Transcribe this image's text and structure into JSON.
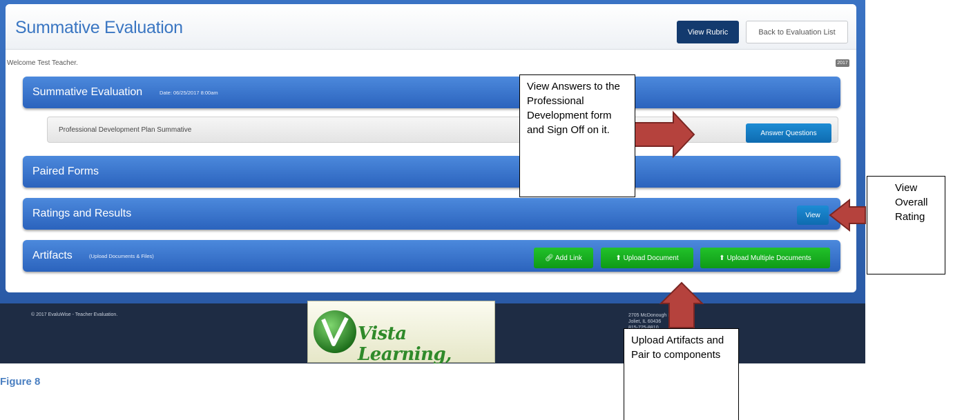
{
  "header": {
    "title": "Summative Evaluation",
    "view_rubric_label": "View Rubric",
    "back_label": "Back to Evaluation List"
  },
  "welcome_text": "Welcome Test Teacher.",
  "year_badge": "2017",
  "sections": {
    "summative": {
      "title": "Summative Evaluation",
      "date": "Date: 06/25/2017 8:00am",
      "item_label": "Professional Development Plan Summative",
      "answer_label": "Answer Questions"
    },
    "paired_forms": {
      "title": "Paired Forms"
    },
    "ratings": {
      "title": "Ratings and Results",
      "view_label": "View"
    },
    "artifacts": {
      "title": "Artifacts",
      "subtitle": "(Upload Documents & Files)",
      "add_link_label": "Add Link",
      "upload_doc_label": "Upload Document",
      "upload_multi_label": "Upload Multiple Documents"
    }
  },
  "footer": {
    "copyright": "© 2017 EvaluWise - Teacher Evaluation.",
    "address_line1": "2705 McDonough St.",
    "address_line2": "Joliet, IL 60436",
    "address_line3": "815-725-8810",
    "logo_text": "Vista Learning, NFP"
  },
  "callouts": {
    "answers": "View Answers to the Professional Development form and Sign Off on it.",
    "rating": "View Overall Rating",
    "artifacts": "Upload Artifacts and Pair to components"
  },
  "caption": "Figure 8",
  "colors": {
    "accent_blue": "#2b63bd",
    "dark_navy": "#133a6e",
    "green": "#0f9a17",
    "arrow_red": "#b5423d"
  }
}
